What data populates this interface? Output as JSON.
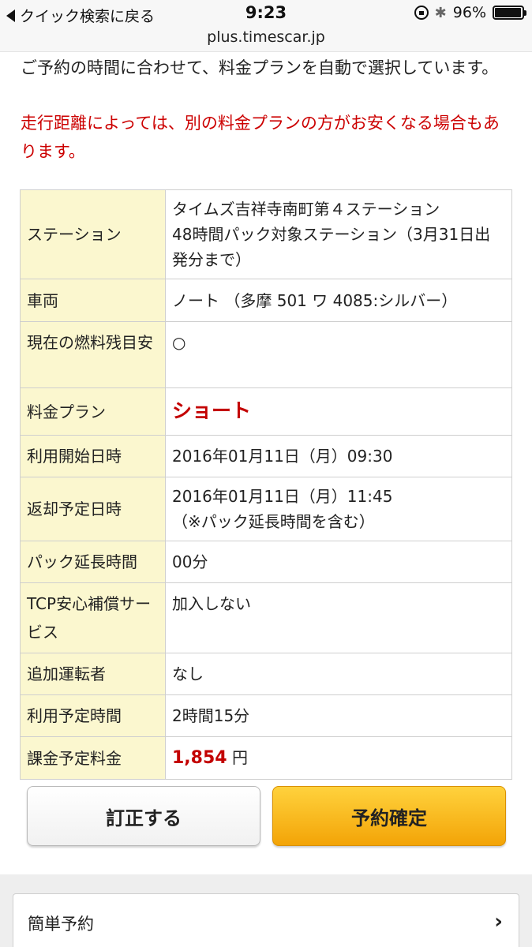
{
  "status_bar": {
    "back_label": "クイック検索に戻る",
    "time": "9:23",
    "battery": "96%",
    "battery_level": 0.96,
    "icons": [
      "back-arrow-icon",
      "orientation-lock-icon",
      "bluetooth-icon",
      "battery-icon"
    ]
  },
  "url": "plus.timescar.jp",
  "intro_text": "ご予約の時間に合わせて、料金プランを自動で選択しています。",
  "warning_text": "走行距離によっては、別の料金プランの方がお安くなる場合もあります。",
  "details": {
    "station": {
      "label": "ステーション",
      "value_line1": "タイムズ吉祥寺南町第４ステーション",
      "value_line2": "48時間パック対象ステーション（3月31日出発分まで）"
    },
    "vehicle": {
      "label": "車両",
      "value": "ノート （多摩 501 ワ 4085:シルバー）"
    },
    "fuel": {
      "label": "現在の燃料残目安",
      "value": "○"
    },
    "plan": {
      "label": "料金プラン",
      "value": "ショート"
    },
    "start": {
      "label": "利用開始日時",
      "value": "2016年01月11日（月）09:30"
    },
    "return": {
      "label": "返却予定日時",
      "value_line1": "2016年01月11日（月）11:45",
      "value_line2": "（※パック延長時間を含む）"
    },
    "pack_ext": {
      "label": "パック延長時間",
      "value": "00分"
    },
    "tcp": {
      "label": "TCP安心補償サービス",
      "value": "加入しない"
    },
    "extra_driver": {
      "label": "追加運転者",
      "value": "なし"
    },
    "duration": {
      "label": "利用予定時間",
      "value": "2時間15分"
    },
    "fee": {
      "label": "課金予定料金",
      "amount": "1,854",
      "unit": "円"
    }
  },
  "buttons": {
    "correct": "訂正する",
    "confirm": "予約確定"
  },
  "quick_reservation": {
    "label": "簡単予約",
    "chevron": "›"
  },
  "colors": {
    "header_cell_bg": "#fbf7cf",
    "accent_red": "#c30000",
    "confirm_button": "#f7b31a"
  }
}
